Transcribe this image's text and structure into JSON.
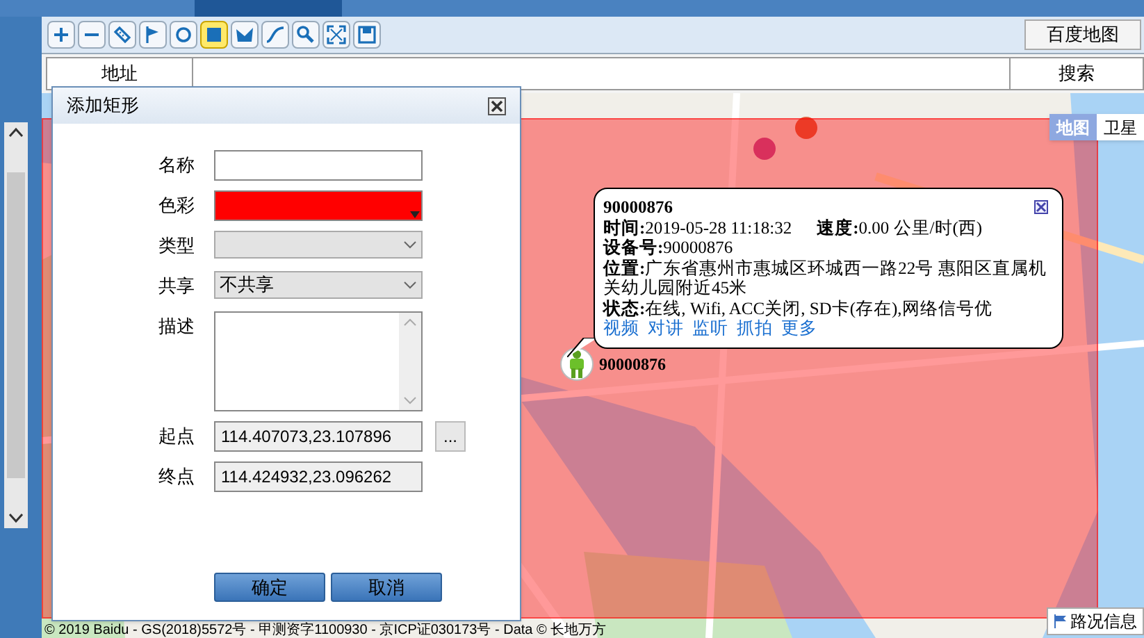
{
  "toolbar": {
    "tools": [
      {
        "kind": "plus",
        "selected": false
      },
      {
        "kind": "minus",
        "selected": false
      },
      {
        "kind": "ruler",
        "selected": false
      },
      {
        "kind": "flag",
        "selected": false
      },
      {
        "kind": "circle",
        "selected": false
      },
      {
        "kind": "rectangle",
        "selected": true
      },
      {
        "kind": "polygon",
        "selected": false
      },
      {
        "kind": "curve",
        "selected": false
      },
      {
        "kind": "magnifier",
        "selected": false
      },
      {
        "kind": "expand",
        "selected": false
      },
      {
        "kind": "save",
        "selected": false
      }
    ],
    "map_source_button": "百度地图"
  },
  "search": {
    "label": "地址",
    "button": "搜索"
  },
  "map": {
    "map_types": [
      {
        "label": "地图",
        "selected": true
      },
      {
        "label": "卫星",
        "selected": false
      }
    ],
    "marker": {
      "label": "90000876"
    },
    "popup": {
      "title": "90000876",
      "time": "**时间:**2019-05-28 11:18:32",
      "speed": "**速度:**0.00 公里/时(西)",
      "lines": [
        "**设备号:**90000876",
        "**位置:**广东省惠州市惠城区环城西一路22号 惠阳区直属机关幼儿园附近45米",
        "**状态:**在线, Wifi, ACC关闭, SD卡(存在),网络信号优"
      ],
      "links": [
        "视频",
        "对讲",
        "监听",
        "抓拍",
        "更多"
      ]
    },
    "road_info_button": "路况信息",
    "copyright": "© 2019 Baidu - GS(2018)5572号 - 甲测资字1100930 - 京ICP证030173号 - Data © 长地万方"
  },
  "dialog": {
    "title": "添加矩形",
    "fields": [
      {
        "kind": "text",
        "label": "名称"
      },
      {
        "kind": "color",
        "label": "色彩",
        "color": "#ff0000"
      },
      {
        "kind": "select",
        "label": "类型"
      },
      {
        "kind": "select",
        "label": "共享",
        "value": "不共享"
      },
      {
        "kind": "textarea",
        "label": "描述"
      },
      {
        "kind": "readonly",
        "label": "起点",
        "value": "114.407073,23.107896",
        "button": "..."
      },
      {
        "kind": "readonly",
        "label": "终点",
        "value": "114.424932,23.096262"
      }
    ],
    "buttons": [
      "确定",
      "取消"
    ]
  }
}
